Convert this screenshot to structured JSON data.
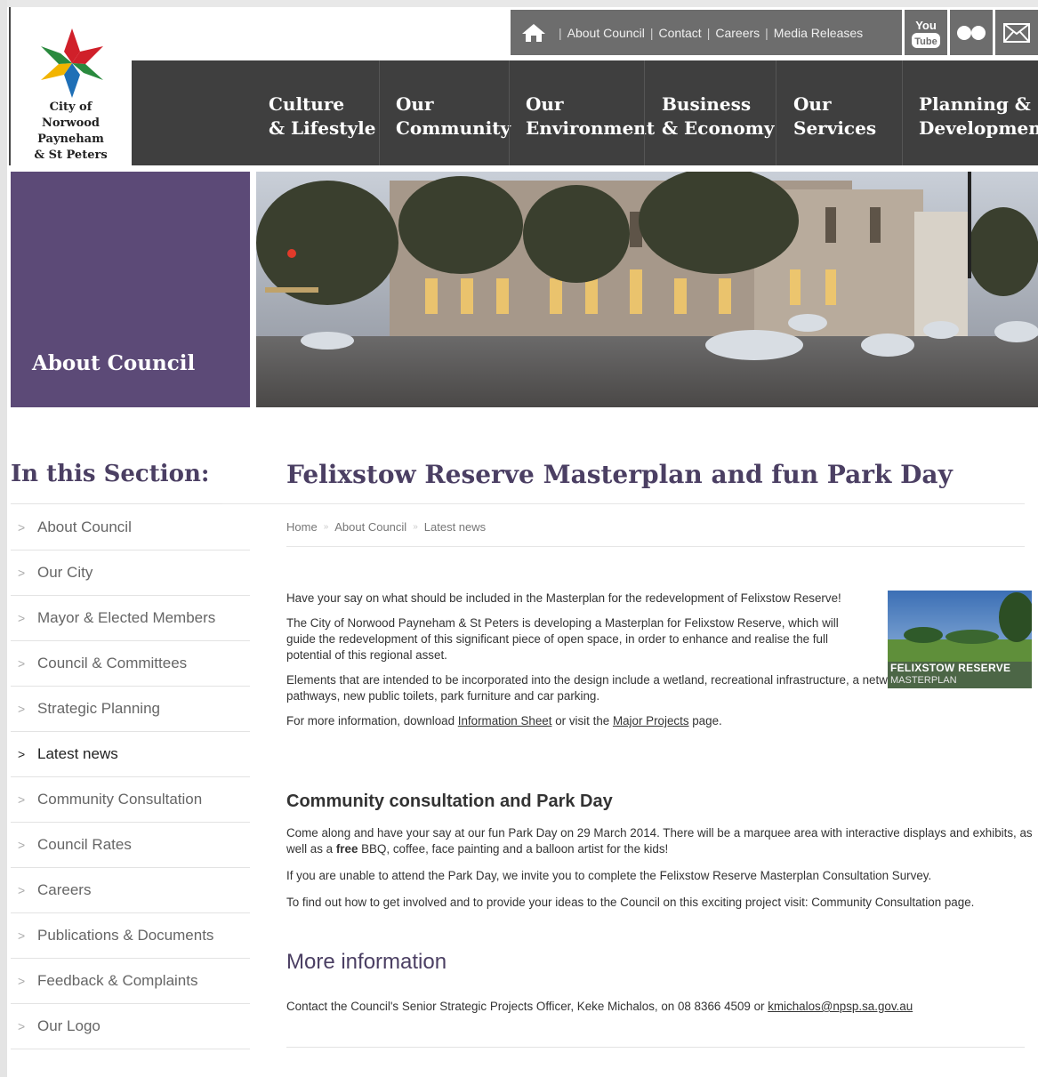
{
  "logo": {
    "lines": [
      "City of",
      "Norwood",
      "Payneham",
      "& St Peters"
    ],
    "colors": [
      "#d0202a",
      "#f2b400",
      "#2a8a3e",
      "#1f6fb6"
    ]
  },
  "utility": {
    "home_icon": "home-icon",
    "links": [
      "About Council",
      "Contact",
      "Careers",
      "Media Releases"
    ],
    "separator": "|"
  },
  "social": {
    "youtube_top": "You",
    "youtube_bottom": "Tube",
    "flickr_icon": "flickr-icon",
    "email_icon": "envelope-icon"
  },
  "nav": [
    {
      "line1": "Culture",
      "line2": "& Lifestyle"
    },
    {
      "line1": "Our",
      "line2": "Community"
    },
    {
      "line1": "Our",
      "line2": "Environment"
    },
    {
      "line1": "Business",
      "line2": "& Economy"
    },
    {
      "line1": "Our",
      "line2": "Services"
    },
    {
      "line1": "Planning &",
      "line2": "Development"
    }
  ],
  "hero": {
    "section_title": "About Council"
  },
  "sidebar": {
    "heading": "In this Section:",
    "chevron": ">",
    "items": [
      "About Council",
      "Our City",
      "Mayor & Elected Members",
      "Council & Committees",
      "Strategic Planning",
      "Latest news",
      "Community Consultation",
      "Council Rates",
      "Careers",
      "Publications & Documents",
      "Feedback & Complaints",
      "Our Logo"
    ],
    "active_index": 5
  },
  "page": {
    "title": "Felixstow Reserve Masterplan and fun Park Day",
    "breadcrumb": [
      "Home",
      "About Council",
      "Latest news"
    ],
    "breadcrumb_sep": "»",
    "p1": "Have your say on what should be included in the Masterplan for the redevelopment of Felixstow Reserve!",
    "p2": "The City of Norwood Payneham & St Peters is developing a Masterplan for Felixstow Reserve, which will guide the redevelopment of this significant piece of open space, in order to enhance and realise the full potential of this regional asset.",
    "p3": "Elements that are intended to be incorporated into the design include a wetland, recreational infrastructure, a network of pedestrian and cycle pathways, new public toilets, park furniture and car parking.",
    "p4_before": "For more information, download ",
    "p4_link1": "Information Sheet",
    "p4_mid": " or visit the ",
    "p4_link2": "Major Projects",
    "p4_after": " page.",
    "thumb_title": "FELIXSTOW RESERVE",
    "thumb_sub": "MASTERPLAN",
    "h2": "Community consultation and Park Day",
    "c1_before": "Come along and have your say at our fun Park Day on 29 March 2014. There will be a marquee area with interactive displays and exhibits, as well as a ",
    "c1_bold": "free",
    "c1_after": " BBQ, coffee, face painting and a balloon artist for the kids!",
    "c2": "If you are unable to attend the Park Day, we invite you to complete the Felixstow Reserve Masterplan Consultation Survey.",
    "c3": "To find out how to get involved and to provide your ideas to the Council on this exciting project visit: Community Consultation page.",
    "h3": "More information",
    "contact_before": "Contact the Council's Senior Strategic Projects Officer, Keke Michalos, on 08 8366 4509 or ",
    "contact_email": "kmichalos@npsp.sa.gov.au"
  },
  "colors": {
    "nav_bg": "#3f3f3f",
    "utility_bg": "#6d6d6d",
    "section_panel": "#5c4a77",
    "heading": "#4b3f63"
  }
}
